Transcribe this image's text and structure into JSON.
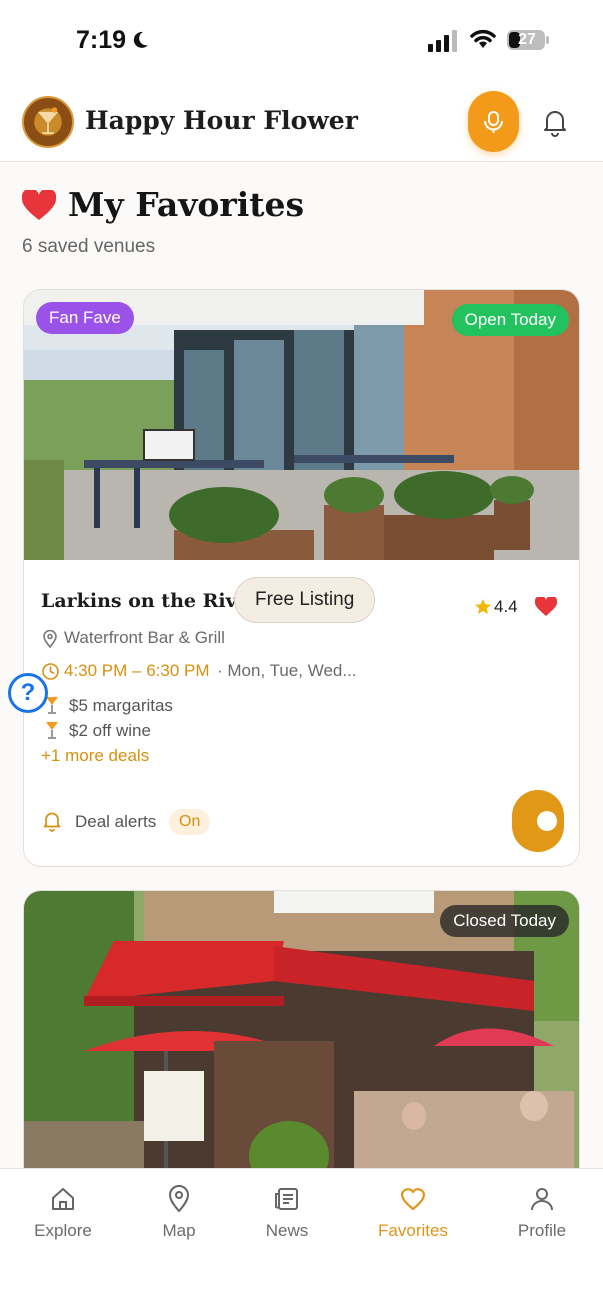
{
  "status": {
    "time": "7:19",
    "battery": "27"
  },
  "header": {
    "app_title": "Happy Hour Flower"
  },
  "page": {
    "title": "My Favorites",
    "saved_count": "6 saved venues"
  },
  "venues": [
    {
      "badge_left": "Fan Fave",
      "badge_right": "Open Today",
      "name": "Larkins on the River",
      "listing": "Free Listing",
      "rating": "4.4",
      "type": "Waterfront Bar & Grill",
      "hours": "4:30 PM – 6:30 PM",
      "days": "· Mon, Tue, Wed...",
      "deals": [
        "$5 margaritas",
        "$2 off wine"
      ],
      "more_deals": "+1 more deals",
      "alerts_label": "Deal alerts",
      "alerts_state": "On"
    },
    {
      "badge_right": "Closed Today"
    }
  ],
  "help_label": "?",
  "tabs": [
    {
      "label": "Explore",
      "icon": "home-icon"
    },
    {
      "label": "Map",
      "icon": "map-pin-icon"
    },
    {
      "label": "News",
      "icon": "newspaper-icon"
    },
    {
      "label": "Favorites",
      "icon": "heart-icon",
      "active": true
    },
    {
      "label": "Profile",
      "icon": "user-icon"
    }
  ],
  "colors": {
    "accent": "#e0951a",
    "open": "#22c35e",
    "fan_fave": "#9b52e8",
    "heart": "#e8353b"
  }
}
